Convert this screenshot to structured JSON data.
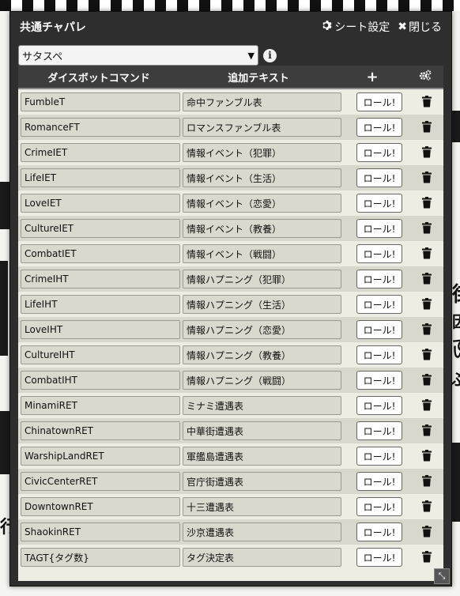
{
  "window": {
    "title": "共通チャパレ",
    "sheet_settings_label": "シート設定",
    "close_label": "閉じる"
  },
  "selector": {
    "value": "サタスペ"
  },
  "table": {
    "headers": {
      "command": "ダイスボットコマンド",
      "text": "追加テキスト"
    },
    "roll_label": "ロール!",
    "rows": [
      {
        "command": "FumbleT",
        "text": "命中ファンブル表"
      },
      {
        "command": "RomanceFT",
        "text": "ロマンスファンブル表"
      },
      {
        "command": "CrimeIET",
        "text": "情報イベント（犯罪）"
      },
      {
        "command": "LifeIET",
        "text": "情報イベント（生活）"
      },
      {
        "command": "LoveIET",
        "text": "情報イベント（恋愛）"
      },
      {
        "command": "CultureIET",
        "text": "情報イベント（教養）"
      },
      {
        "command": "CombatIET",
        "text": "情報イベント（戦闘）"
      },
      {
        "command": "CrimeIHT",
        "text": "情報ハプニング（犯罪）"
      },
      {
        "command": "LifeIHT",
        "text": "情報ハプニング（生活）"
      },
      {
        "command": "LoveIHT",
        "text": "情報ハプニング（恋愛）"
      },
      {
        "command": "CultureIHT",
        "text": "情報ハプニング（教養）"
      },
      {
        "command": "CombatIHT",
        "text": "情報ハプニング（戦闘）"
      },
      {
        "command": "MinamiRET",
        "text": "ミナミ遭遇表"
      },
      {
        "command": "ChinatownRET",
        "text": "中華街遭遇表"
      },
      {
        "command": "WarshipLandRET",
        "text": "軍艦島遭遇表"
      },
      {
        "command": "CivicCenterRET",
        "text": "官庁街遭遇表"
      },
      {
        "command": "DowntownRET",
        "text": "十三遭遇表"
      },
      {
        "command": "ShaokinRET",
        "text": "沙京遭遇表"
      },
      {
        "command": "TAGT{タグ数}",
        "text": "タグ決定表"
      }
    ]
  },
  "background": {
    "snippet1": "街",
    "snippet2": "因で",
    "snippet3": "い",
    "snippet4": "ぶ",
    "snippet5": "行"
  }
}
